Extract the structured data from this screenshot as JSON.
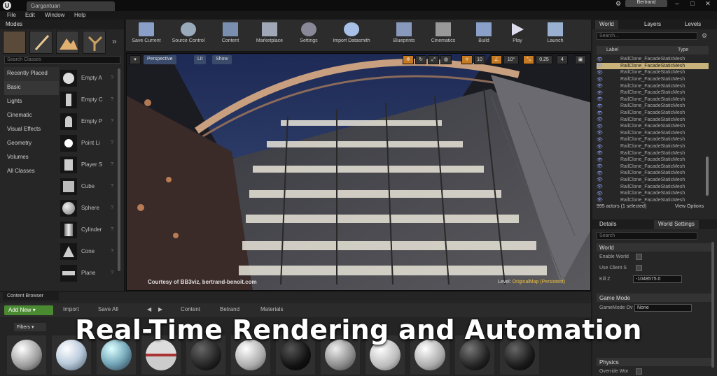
{
  "window": {
    "tab_title": "Gargantuan",
    "user": "Bertrand"
  },
  "menu": [
    "File",
    "Edit",
    "Window",
    "Help"
  ],
  "modes": {
    "title": "Modes",
    "search_placeholder": "Search Classes",
    "categories": [
      "Recently Placed",
      "Basic",
      "Lights",
      "Cinematic",
      "Visual Effects",
      "Geometry",
      "Volumes",
      "All Classes"
    ],
    "items": [
      "Empty A",
      "Empty C",
      "Empty P",
      "Point Li",
      "Player S",
      "Cube",
      "Sphere",
      "Cylinder",
      "Cone",
      "Plane"
    ]
  },
  "toolbar": [
    {
      "label": "Save Current",
      "icon": "save-icon"
    },
    {
      "label": "Source Control",
      "icon": "source-control-icon"
    },
    {
      "label": "Content",
      "icon": "content-icon"
    },
    {
      "label": "Marketplace",
      "icon": "marketplace-icon"
    },
    {
      "label": "Settings",
      "icon": "settings-icon"
    },
    {
      "label": "Import Datasmith",
      "icon": "datasmith-icon"
    },
    {
      "label": "Blueprints",
      "icon": "blueprints-icon"
    },
    {
      "label": "Cinematics",
      "icon": "cinematics-icon"
    },
    {
      "label": "Build",
      "icon": "build-icon"
    },
    {
      "label": "Play",
      "icon": "play-icon"
    },
    {
      "label": "Launch",
      "icon": "launch-icon"
    }
  ],
  "viewport": {
    "perspective": "Perspective",
    "lit": "Lit",
    "show": "Show",
    "grid": "10",
    "angle": "10°",
    "scale": "0.25",
    "cams": "4",
    "courtesy": "Courtesy of BB3viz, bertrand-benoit.com",
    "level_label": "Level:",
    "level_name": "OriginalMap (Persistent)"
  },
  "outliner": {
    "tabs": [
      "World",
      "Layers",
      "Levels"
    ],
    "search_placeholder": "Search...",
    "col_label": "Label",
    "col_type": "Type",
    "rows": [
      "RailClone_FacadeStaticMesh",
      "RailClone_FacadeStaticMesh",
      "RailClone_FacadeStaticMesh",
      "RailClone_FacadeStaticMesh",
      "RailClone_FacadeStaticMesh",
      "RailClone_FacadeStaticMesh",
      "RailClone_FacadeStaticMesh",
      "RailClone_FacadeStaticMesh",
      "RailClone_FacadeStaticMesh",
      "RailClone_FacadeStaticMesh",
      "RailClone_FacadeStaticMesh",
      "RailClone_FacadeStaticMesh",
      "RailClone_FacadeStaticMesh",
      "RailClone_FacadeStaticMesh",
      "RailClone_FacadeStaticMesh",
      "RailClone_FacadeStaticMesh",
      "RailClone_FacadeStaticMesh",
      "RailClone_FacadeStaticMesh",
      "RailClone_FacadeStaticMesh",
      "RailClone_FacadeStaticMesh",
      "RailClone_FacadeStaticMesh",
      "RailClone_FacadeStaticMesh"
    ],
    "selected_index": 1,
    "footer_count": "995 actors (1 selected)",
    "view_options": "View Options"
  },
  "details": {
    "tabs": [
      "Details",
      "World Settings"
    ],
    "search_placeholder": "Search",
    "section_world": "World",
    "enable_world": "Enable World",
    "use_client": "Use Client S",
    "kill_z_label": "Kill Z",
    "kill_z_value": "-1048575.0",
    "section_game": "Game Mode",
    "game_mode_override": "GameMode Ov",
    "game_mode_value": "None",
    "section_physics": "Physics",
    "override_world": "Override Wor"
  },
  "content_browser": {
    "tab": "Content Browser",
    "add_new": "Add New",
    "import": "Import",
    "save_all": "Save All",
    "breadcrumb": [
      "Content",
      "Betrand",
      "Materials"
    ],
    "filters": "Filters"
  },
  "overlay_title": "Real-Time Rendering and Automation"
}
